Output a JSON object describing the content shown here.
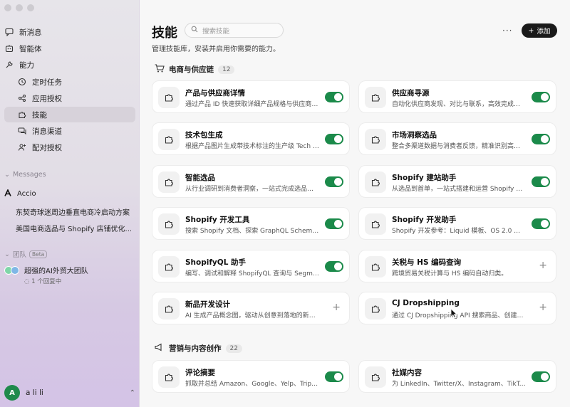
{
  "sidebar": {
    "nav": [
      {
        "label": "新消息",
        "icon": "message-icon"
      },
      {
        "label": "智能体",
        "icon": "robot-icon"
      },
      {
        "label": "能力",
        "icon": "wrench-icon"
      }
    ],
    "subnav": [
      {
        "label": "定时任务",
        "icon": "clock-icon"
      },
      {
        "label": "应用授权",
        "icon": "share-icon"
      },
      {
        "label": "技能",
        "icon": "puzzle-icon"
      },
      {
        "label": "消息渠道",
        "icon": "chat-icon"
      },
      {
        "label": "配对授权",
        "icon": "user-pair-icon"
      }
    ],
    "messages_label": "Messages",
    "messages": [
      "Accio",
      "东契奇球迷周边垂直电商冷启动方案",
      "美国电商选品与 Shopify 店铺优化..."
    ],
    "team_label": "团队",
    "beta": "Beta",
    "team": {
      "name": "超强的AI外贸大团队",
      "status": "1 个回复中"
    },
    "user": {
      "initial": "A",
      "name": "a li li"
    }
  },
  "main": {
    "title": "技能",
    "search_placeholder": "搜索技能",
    "more": "···",
    "add_label": "添加",
    "subtitle": "管理技能库，安装并启用你需要的能力。",
    "categories": [
      {
        "name": "电商与供应链",
        "count": "12"
      },
      {
        "name": "营销与内容创作",
        "count": "22"
      }
    ],
    "skills": [
      {
        "name": "产品与供应商详情",
        "desc": "通过产品 ID 快速获取详细产品规格与供应商信...",
        "on": true
      },
      {
        "name": "供应商寻源",
        "desc": "自动化供应商发现、对比与联系，高效完成产...",
        "on": true
      },
      {
        "name": "技术包生成",
        "desc": "根据产品图片生成带技术标注的生产级 Tech P...",
        "on": true
      },
      {
        "name": "市场洞察选品",
        "desc": "整合多渠道数据与消费者反馈，精准识别高潜...",
        "on": true
      },
      {
        "name": "智能选品",
        "desc": "从行业调研到消费者洞察，一站式完成选品与...",
        "on": true
      },
      {
        "name": "Shopify 建站助手",
        "desc": "从选品到首单，一站式搭建和运营 Shopify 独...",
        "on": true
      },
      {
        "name": "Shopify 开发工具",
        "desc": "搜索 Shopify 文档、探索 GraphQL Schema、...",
        "on": true
      },
      {
        "name": "Shopify 开发助手",
        "desc": "Shopify 开发参考：Liquid 模板、OS 2.0 主题...",
        "on": true
      },
      {
        "name": "ShopifyQL 助手",
        "desc": "编写、调试和解释 ShopifyQL 查询与 Segmen...",
        "on": true
      },
      {
        "name": "关税与 HS 编码查询",
        "desc": "跨境贸易关税计算与 HS 编码自动归类。",
        "on": false
      },
      {
        "name": "新品开发设计",
        "desc": "AI 生成产品概念图，驱动从创意到落地的新品...",
        "on": false
      },
      {
        "name": "CJ Dropshipping",
        "desc": "通过 CJ Dropshipping API 搜索商品、创建订单...",
        "on": false
      },
      {
        "name": "评论摘要",
        "desc": "抓取并总结 Amazon、Google、Yelp、TripAd...",
        "on": true
      },
      {
        "name": "社媒内容",
        "desc": "为 LinkedIn、Twitter/X、Instagram、TikTok...",
        "on": true
      }
    ]
  }
}
